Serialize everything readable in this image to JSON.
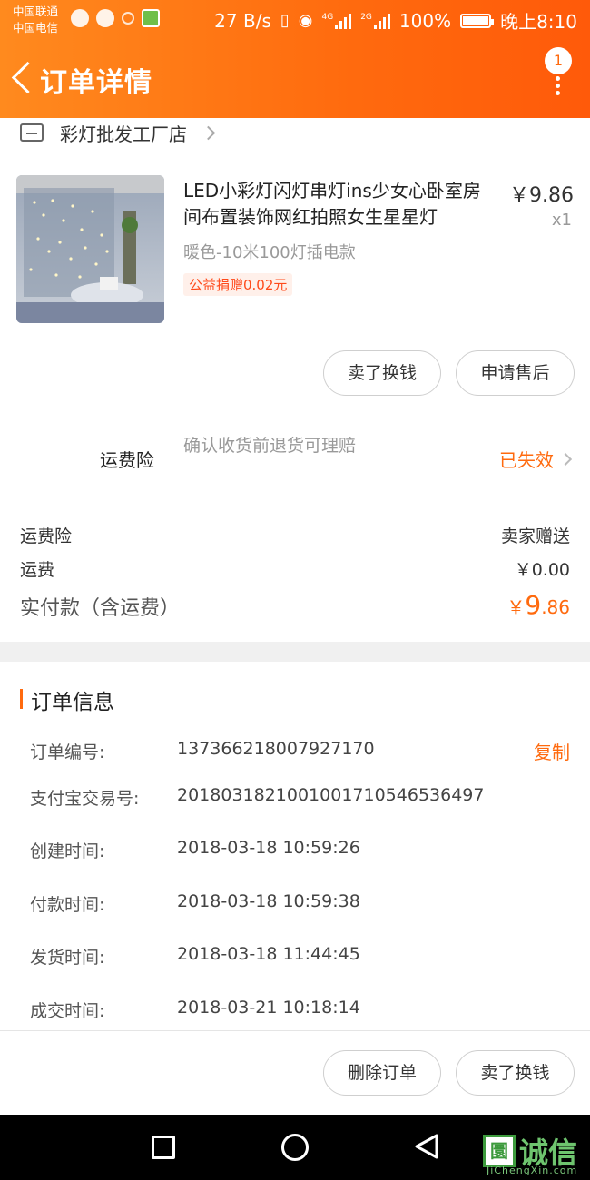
{
  "status_bar": {
    "carrier1": "中国联通",
    "carrier2": "中国电信",
    "net_speed": "27 B/s",
    "net_type1": "4G",
    "net_type2": "2G",
    "battery": "100%",
    "time": "晚上8:10"
  },
  "header": {
    "title": "订单详情",
    "badge_count": "1"
  },
  "shop": {
    "name": "彩灯批发工厂店"
  },
  "product": {
    "name": "LED小彩灯闪灯串灯ins少女心卧室房间布置装饰网红拍照女生星星灯",
    "price": "￥9.86",
    "quantity": "x1",
    "sku": "暖色-10米100灯插电款",
    "charity": "公益捐赠0.02元"
  },
  "item_actions": {
    "sell": "卖了换钱",
    "after_sale": "申请售后"
  },
  "insurance": {
    "label": "运费险",
    "desc": "确认收货前退货可理赔",
    "status": "已失效"
  },
  "fees": {
    "insurance_label": "运费险",
    "insurance_value": "卖家赠送",
    "shipping_label": "运费",
    "shipping_value": "￥0.00",
    "total_label": "实付款（含运费）",
    "total_currency": "￥",
    "total_int": "9",
    "total_dec": ".86"
  },
  "order_info": {
    "title": "订单信息",
    "copy_label": "复制",
    "rows": [
      {
        "label": "订单编号:",
        "value": "137366218007927170"
      },
      {
        "label": "支付宝交易号:",
        "value": "2018031821001001710546536497"
      },
      {
        "label": "创建时间:",
        "value": "2018-03-18 10:59:26"
      },
      {
        "label": "付款时间:",
        "value": "2018-03-18 10:59:38"
      },
      {
        "label": "发货时间:",
        "value": "2018-03-18 11:44:45"
      },
      {
        "label": "成交时间:",
        "value": "2018-03-21 10:18:14"
      }
    ]
  },
  "bottom_actions": {
    "delete": "删除订单",
    "sell": "卖了换钱"
  },
  "watermark": {
    "glyph": "圜",
    "text": "诚信",
    "url": "JiChengXin.com"
  },
  "colors": {
    "brand_orange": "#ff6a0e",
    "charity_red": "#ff4a1a",
    "watermark_green": "#3c9a3c"
  }
}
